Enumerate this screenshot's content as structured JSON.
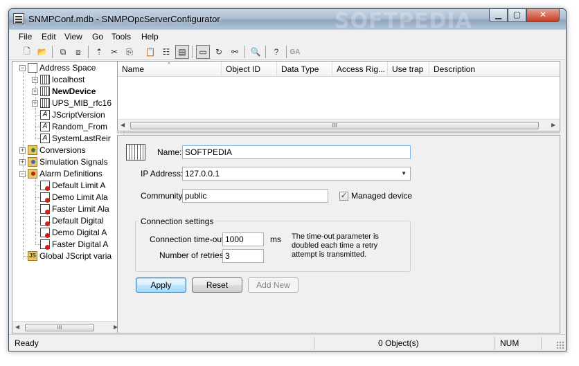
{
  "window": {
    "title": "SNMPConf.mdb - SNMPOpcServerConfigurator",
    "watermark": "SOFTPEDIA",
    "min_glyph": "▁",
    "max_glyph": "▢",
    "close_glyph": "✕"
  },
  "menu": [
    "File",
    "Edit",
    "View",
    "Go",
    "Tools",
    "Help"
  ],
  "toolbar": {
    "disabled_label": "GA"
  },
  "tree": {
    "items": [
      {
        "label": "Address Space",
        "icon": "address-space-icon"
      },
      {
        "label": "localhost",
        "icon": "device-icon"
      },
      {
        "label": "NewDevice",
        "icon": "device-icon"
      },
      {
        "label": "UPS_MIB_rfc16",
        "icon": "device-icon"
      },
      {
        "label": "JScriptVersion",
        "icon": "script-icon"
      },
      {
        "label": "Random_From",
        "icon": "script-icon"
      },
      {
        "label": "SystemLastReir",
        "icon": "script-icon"
      },
      {
        "label": "Conversions",
        "icon": "conversions-folder-icon"
      },
      {
        "label": "Simulation Signals",
        "icon": "simulation-folder-icon"
      },
      {
        "label": "Alarm Definitions",
        "icon": "alarm-folder-icon"
      },
      {
        "label": "Default Limit A",
        "icon": "alarm-icon"
      },
      {
        "label": "Demo Limit Ala",
        "icon": "alarm-icon"
      },
      {
        "label": "Faster Limit Ala",
        "icon": "alarm-icon"
      },
      {
        "label": "Default Digital",
        "icon": "alarm-icon"
      },
      {
        "label": "Demo Digital A",
        "icon": "alarm-icon"
      },
      {
        "label": "Faster Digital A",
        "icon": "alarm-icon"
      },
      {
        "label": "Global JScript varia",
        "icon": "jscript-icon"
      }
    ],
    "scroll_grip": "III"
  },
  "list": {
    "columns": [
      "Name",
      "Object ID",
      "Data Type",
      "Access Rig...",
      "Use trap",
      "Description"
    ],
    "sort_glyph": "^",
    "scroll_grip": "III"
  },
  "detail": {
    "name_label": "Name:",
    "name_value": "SOFTPEDIA",
    "ip_label": "IP Address:",
    "ip_value": "127.0.0.1",
    "community_label": "Community:",
    "community_value": "public",
    "managed_label": "Managed device",
    "managed_checked": true,
    "check_glyph": "✓",
    "dropdown_glyph": "▼",
    "group_title": "Connection settings",
    "timeout_label": "Connection time-out:",
    "timeout_value": "1000",
    "timeout_unit": "ms",
    "retries_label": "Number of retries:",
    "retries_value": "3",
    "note_lines": [
      "The time-out parameter is",
      "doubled each time a retry",
      "attempt is transmitted."
    ]
  },
  "buttons": {
    "apply": "Apply",
    "reset": "Reset",
    "add_new": "Add New"
  },
  "status": {
    "left": "Ready",
    "objects": "0 Object(s)",
    "num": "NUM"
  }
}
